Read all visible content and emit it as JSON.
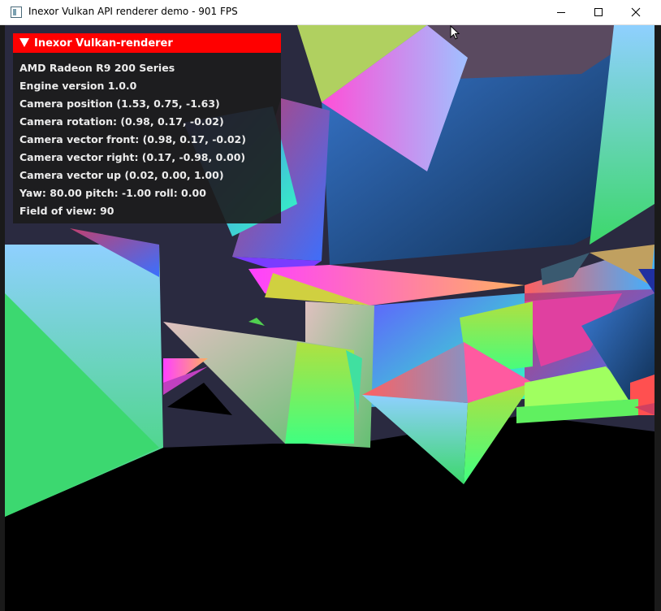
{
  "window": {
    "title": "Inexor Vulkan API renderer demo - 901 FPS",
    "controls": {
      "minimize": "minimize-icon",
      "maximize": "maximize-icon",
      "close": "close-icon"
    }
  },
  "overlay": {
    "title": "Inexor Vulkan-renderer",
    "header_color": "#ff0000",
    "lines": [
      "AMD Radeon R9 200 Series",
      "Engine version 1.0.0",
      "Camera position (1.53, 0.75, -1.63)",
      "Camera rotation: (0.98, 0.17, -0.02)",
      "Camera vector front: (0.98, 0.17, -0.02)",
      "Camera vector right: (0.17, -0.98, 0.00)",
      "Camera vector up (0.02, 0.00, 1.00)",
      "Yaw: 80.00 pitch: -1.00 roll: 0.00",
      "Field of view: 90"
    ]
  }
}
